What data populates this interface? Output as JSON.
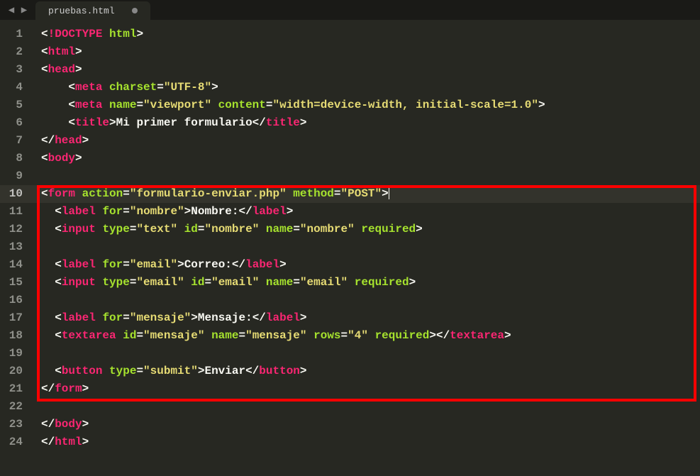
{
  "tab": {
    "filename": "pruebas.html",
    "dirty": true
  },
  "lines": [
    "1",
    "2",
    "3",
    "4",
    "5",
    "6",
    "7",
    "8",
    "9",
    "10",
    "11",
    "12",
    "13",
    "14",
    "15",
    "16",
    "17",
    "18",
    "19",
    "20",
    "21",
    "22",
    "23",
    "24"
  ],
  "active_line": 10,
  "code": {
    "l1": {
      "open": "<",
      "bang": "!",
      "doctype": "DOCTYPE",
      "sp": " ",
      "attr": "html",
      "close": ">"
    },
    "l2": {
      "open": "<",
      "tag": "html",
      "close": ">"
    },
    "l3": {
      "open": "<",
      "tag": "head",
      "close": ">"
    },
    "l4": {
      "open": "<",
      "tag": "meta",
      "sp1": " ",
      "a1": "charset",
      "eq": "=",
      "v1": "\"UTF-8\"",
      "close": ">"
    },
    "l5": {
      "open": "<",
      "tag": "meta",
      "sp1": " ",
      "a1": "name",
      "eq1": "=",
      "v1": "\"viewport\"",
      "sp2": " ",
      "a2": "content",
      "eq2": "=",
      "v2": "\"width=device-width, initial-scale=1.0\"",
      "close": ">"
    },
    "l6": {
      "open": "<",
      "tag": "title",
      "close": ">",
      "text": "Mi primer formulario",
      "open2": "</",
      "tag2": "title",
      "close2": ">"
    },
    "l7": {
      "open": "</",
      "tag": "head",
      "close": ">"
    },
    "l8": {
      "open": "<",
      "tag": "body",
      "close": ">"
    },
    "l10": {
      "open": "<",
      "tag": "form",
      "sp1": " ",
      "a1": "action",
      "eq1": "=",
      "v1": "\"formulario-enviar.php\"",
      "sp2": " ",
      "a2": "method",
      "eq2": "=",
      "v2": "\"POST\"",
      "close": ">"
    },
    "l11": {
      "open": "<",
      "tag": "label",
      "sp1": " ",
      "a1": "for",
      "eq1": "=",
      "v1": "\"nombre\"",
      "close": ">",
      "text": "Nombre:",
      "open2": "</",
      "tag2": "label",
      "close2": ">"
    },
    "l12": {
      "open": "<",
      "tag": "input",
      "sp1": " ",
      "a1": "type",
      "eq1": "=",
      "v1": "\"text\"",
      "sp2": " ",
      "a2": "id",
      "eq2": "=",
      "v2": "\"nombre\"",
      "sp3": " ",
      "a3": "name",
      "eq3": "=",
      "v3": "\"nombre\"",
      "sp4": " ",
      "a4": "required",
      "close": ">"
    },
    "l14": {
      "open": "<",
      "tag": "label",
      "sp1": " ",
      "a1": "for",
      "eq1": "=",
      "v1": "\"email\"",
      "close": ">",
      "text": "Correo:",
      "open2": "</",
      "tag2": "label",
      "close2": ">"
    },
    "l15": {
      "open": "<",
      "tag": "input",
      "sp1": " ",
      "a1": "type",
      "eq1": "=",
      "v1": "\"email\"",
      "sp2": " ",
      "a2": "id",
      "eq2": "=",
      "v2": "\"email\"",
      "sp3": " ",
      "a3": "name",
      "eq3": "=",
      "v3": "\"email\"",
      "sp4": " ",
      "a4": "required",
      "close": ">"
    },
    "l17": {
      "open": "<",
      "tag": "label",
      "sp1": " ",
      "a1": "for",
      "eq1": "=",
      "v1": "\"mensaje\"",
      "close": ">",
      "text": "Mensaje:",
      "open2": "</",
      "tag2": "label",
      "close2": ">"
    },
    "l18": {
      "open": "<",
      "tag": "textarea",
      "sp1": " ",
      "a1": "id",
      "eq1": "=",
      "v1": "\"mensaje\"",
      "sp2": " ",
      "a2": "name",
      "eq2": "=",
      "v2": "\"mensaje\"",
      "sp3": " ",
      "a3": "rows",
      "eq3": "=",
      "v3": "\"4\"",
      "sp4": " ",
      "a4": "required",
      "close": ">",
      "open2": "</",
      "tag2": "textarea",
      "close2": ">"
    },
    "l20": {
      "open": "<",
      "tag": "button",
      "sp1": " ",
      "a1": "type",
      "eq1": "=",
      "v1": "\"submit\"",
      "close": ">",
      "text": "Enviar",
      "open2": "</",
      "tag2": "button",
      "close2": ">"
    },
    "l21": {
      "open": "</",
      "tag": "form",
      "close": ">"
    },
    "l23": {
      "open": "</",
      "tag": "body",
      "close": ">"
    },
    "l24": {
      "open": "</",
      "tag": "html",
      "close": ">"
    }
  }
}
